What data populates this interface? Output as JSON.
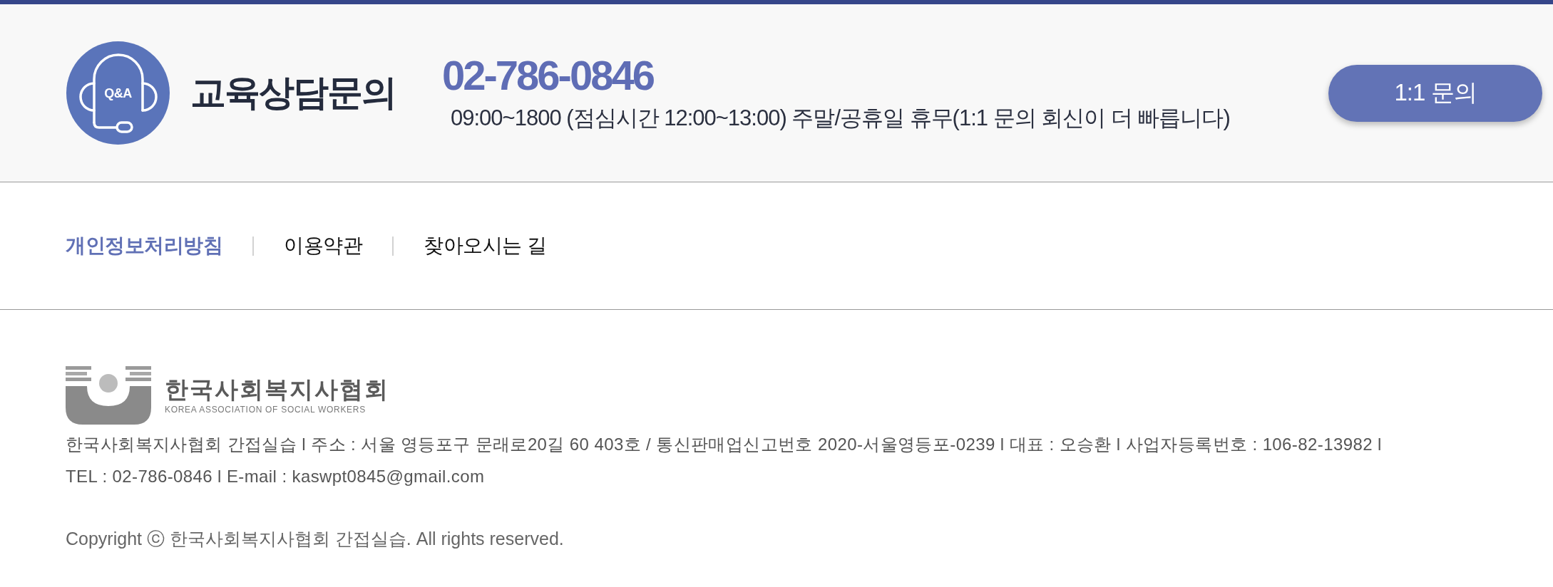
{
  "contact_banner": {
    "icon_label": "Q&A",
    "title": "교육상담문의",
    "phone": "02-786-0846",
    "hours": "09:00~1800 (점심시간 12:00~13:00) 주말/공휴일 휴무(1:1 문의 회신이 더 빠릅니다)",
    "button": "1:1 문의"
  },
  "footer_links": [
    {
      "label": "개인정보처리방침",
      "emphasized": true
    },
    {
      "label": "이용약관",
      "emphasized": false
    },
    {
      "label": "찾아오시는 길",
      "emphasized": false
    }
  ],
  "footer": {
    "logo": {
      "name": "한국사회복지사협회",
      "subtitle": "KOREA ASSOCIATION OF SOCIAL WORKERS"
    },
    "info_lines": [
      "한국사회복지사협회 간접실습 l 주소 : 서울 영등포구 문래로20길 60 403호 / 통신판매업신고번호 2020-서울영등포-0239 l 대표 : 오승환 l 사업자등록번호 : 106-82-13982 l",
      "TEL : 02-786-0846 l E-mail : kaswpt0845@gmail.com"
    ],
    "copyright": "Copyright ⓒ 한국사회복지사협회 간접실습. All rights reserved."
  }
}
